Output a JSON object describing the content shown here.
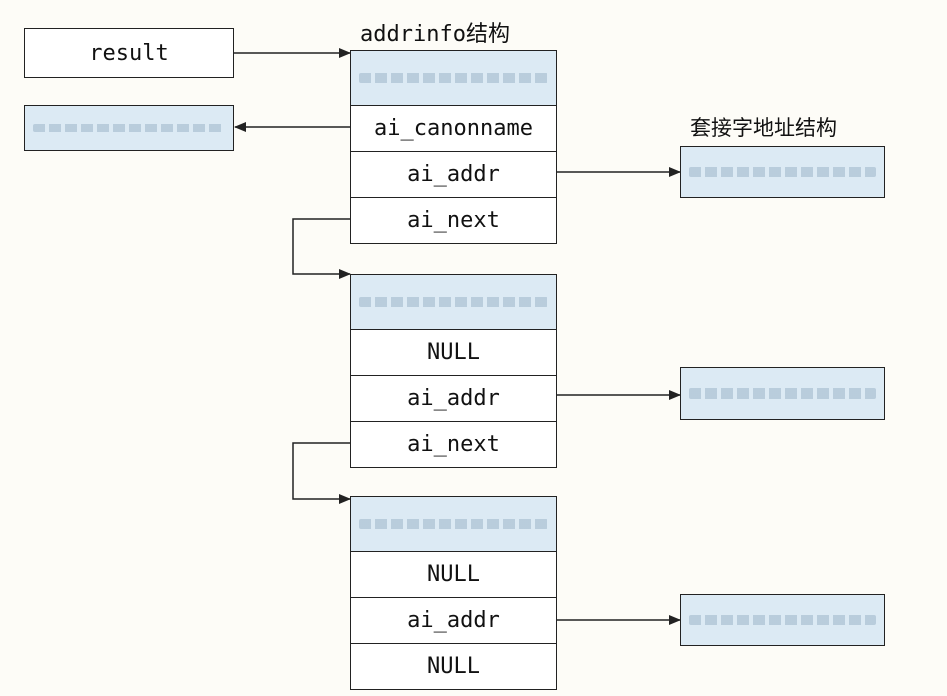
{
  "labels": {
    "addrinfo_struct": "addrinfo结构",
    "socket_addr_struct": "套接字地址结构"
  },
  "result_box": {
    "text": "result"
  },
  "nodes": [
    {
      "fields": [
        "",
        "ai_canonname",
        "ai_addr",
        "ai_next"
      ]
    },
    {
      "fields": [
        "",
        "NULL",
        "ai_addr",
        "ai_next"
      ]
    },
    {
      "fields": [
        "",
        "NULL",
        "ai_addr",
        "NULL"
      ]
    }
  ],
  "colors": {
    "shade": "#dceaf4",
    "line": "#222222"
  }
}
